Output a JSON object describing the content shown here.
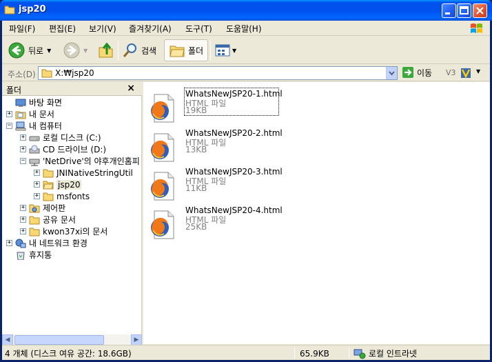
{
  "window": {
    "title": "jsp20"
  },
  "menu": {
    "items": [
      "파일(F)",
      "편집(E)",
      "보기(V)",
      "즐겨찾기(A)",
      "도구(T)",
      "도움말(H)"
    ]
  },
  "toolbar": {
    "back_label": "뒤로",
    "search_label": "검색",
    "folders_label": "폴더"
  },
  "address": {
    "label": "주소(D)",
    "value": "X:₩jsp20",
    "go_label": "이동",
    "v3_label": "V3"
  },
  "folder_pane": {
    "title": "폴더",
    "close_glyph": "×",
    "tree": [
      {
        "label": "바탕 화면",
        "icon": "desktop-icon",
        "level": 0,
        "expander": ""
      },
      {
        "label": "내 문서",
        "icon": "my-documents-icon",
        "level": 1,
        "expander": "+"
      },
      {
        "label": "내 컴퓨터",
        "icon": "my-computer-icon",
        "level": 1,
        "expander": "−"
      },
      {
        "label": "로컬 디스크 (C:)",
        "icon": "hard-drive-icon",
        "level": 2,
        "expander": "+"
      },
      {
        "label": "CD 드라이브 (D:)",
        "icon": "cd-drive-icon",
        "level": 2,
        "expander": "+"
      },
      {
        "label": "'NetDrive'의 야후개인홈피",
        "icon": "network-drive-icon",
        "level": 2,
        "expander": "−"
      },
      {
        "label": "JNINativeStringUtil",
        "icon": "folder-icon",
        "level": 3,
        "expander": "+"
      },
      {
        "label": "jsp20",
        "icon": "folder-open-icon",
        "level": 3,
        "expander": "+",
        "selected": true
      },
      {
        "label": "msfonts",
        "icon": "folder-icon",
        "level": 3,
        "expander": "+"
      },
      {
        "label": "제어판",
        "icon": "control-panel-icon",
        "level": 2,
        "expander": "+"
      },
      {
        "label": "공유 문서",
        "icon": "folder-icon",
        "level": 2,
        "expander": "+"
      },
      {
        "label": "kwon37xi의 문서",
        "icon": "folder-icon",
        "level": 2,
        "expander": "+"
      },
      {
        "label": "내 네트워크 환경",
        "icon": "network-places-icon",
        "level": 1,
        "expander": "+"
      },
      {
        "label": "휴지통",
        "icon": "recycle-bin-icon",
        "level": 1,
        "expander": ""
      }
    ]
  },
  "files": [
    {
      "name": "WhatsNewJSP20-1.html",
      "type": "HTML 파일",
      "size": "19KB",
      "focused": true
    },
    {
      "name": "WhatsNewJSP20-2.html",
      "type": "HTML 파일",
      "size": "13KB"
    },
    {
      "name": "WhatsNewJSP20-3.html",
      "type": "HTML 파일",
      "size": "11KB"
    },
    {
      "name": "WhatsNewJSP20-4.html",
      "type": "HTML 파일",
      "size": "25KB"
    }
  ],
  "status": {
    "objects": "4 개체 (디스크 여유 공간: 18.6GB)",
    "size": "65.9KB",
    "zone": "로컬 인트라넷"
  },
  "colors": {
    "titlebar": "#0053ee",
    "frame": "#ece9d8",
    "folder": "#f8d775"
  }
}
